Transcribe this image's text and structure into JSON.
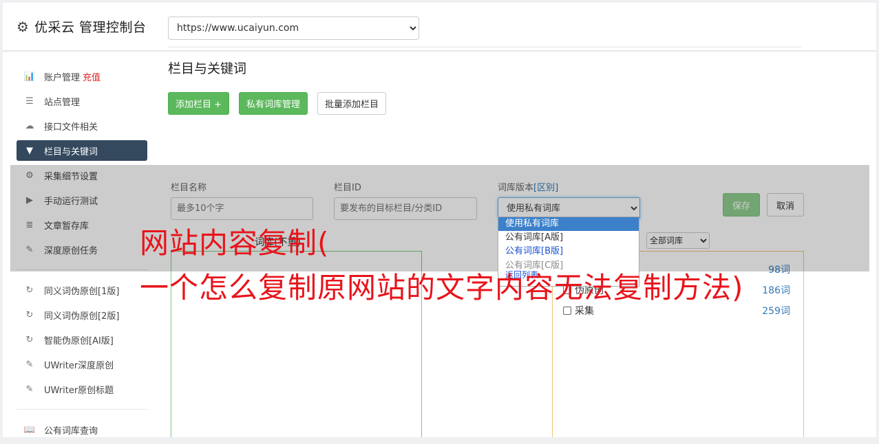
{
  "header": {
    "title": "优采云 管理控制台"
  },
  "sidebar": {
    "group1": [
      {
        "label": "账户管理",
        "badge": "充值",
        "icon": "bar-chart-icon",
        "glyph": "📊"
      },
      {
        "label": "站点管理",
        "icon": "server-icon",
        "glyph": "☰"
      },
      {
        "label": "接口文件相关",
        "icon": "cloud-upload-icon",
        "glyph": "☁"
      },
      {
        "label": "栏目与关键词",
        "icon": "filter-icon",
        "glyph": "▼",
        "active": true
      },
      {
        "label": "采集细节设置",
        "icon": "cogs-icon",
        "glyph": "⚙"
      },
      {
        "label": "手动运行测试",
        "icon": "play-icon",
        "glyph": "▶"
      },
      {
        "label": "文章暂存库",
        "icon": "database-icon",
        "glyph": "≣"
      },
      {
        "label": "深度原创任务",
        "icon": "edit-icon",
        "glyph": "✎"
      }
    ],
    "group2": [
      {
        "label": "同义词伪原创[1版]",
        "icon": "refresh-icon",
        "glyph": "↻"
      },
      {
        "label": "同义词伪原创[2版]",
        "icon": "refresh-icon",
        "glyph": "↻"
      },
      {
        "label": "智能伪原创[AI版]",
        "icon": "refresh-icon",
        "glyph": "↻"
      },
      {
        "label": "UWriter深度原创",
        "icon": "edit-icon",
        "glyph": "✎"
      },
      {
        "label": "UWriter原创标题",
        "icon": "edit-icon",
        "glyph": "✎"
      }
    ],
    "group3": [
      {
        "label": "公有词库查询",
        "icon": "book-icon",
        "glyph": "📖"
      }
    ]
  },
  "content": {
    "site_url": "https://www.ucaiyun.com",
    "section_title": "栏目与关键词",
    "buttons": {
      "add_column": "添加栏目 +",
      "private_lib": "私有词库管理",
      "batch_add": "批量添加栏目"
    },
    "form": {
      "name_label": "栏目名称",
      "name_placeholder": "最多10个字",
      "id_label": "栏目ID",
      "id_placeholder": "要发布的目标栏目/分类ID",
      "version_label": "词库版本",
      "version_link": "[区别]",
      "version_selected": "使用私有词库",
      "save": "保存",
      "cancel": "取消"
    },
    "dropdown_options": [
      "使用私有词库",
      "公有词库[A版]",
      "公有词库[B版]",
      "公有词库[C版]",
      "返回列表"
    ],
    "panel_label_fragment": "词库(不重)",
    "lib_filter": "全部词库",
    "libraries": [
      {
        "name": "",
        "count": "98词"
      },
      {
        "name": "伪原创",
        "count": "186词"
      },
      {
        "name": "采集",
        "count": "259词"
      }
    ]
  },
  "watermark": {
    "line1": "网站内容复制(",
    "line2": "一个怎么复制原网站的文字内容无法复制方法)"
  }
}
